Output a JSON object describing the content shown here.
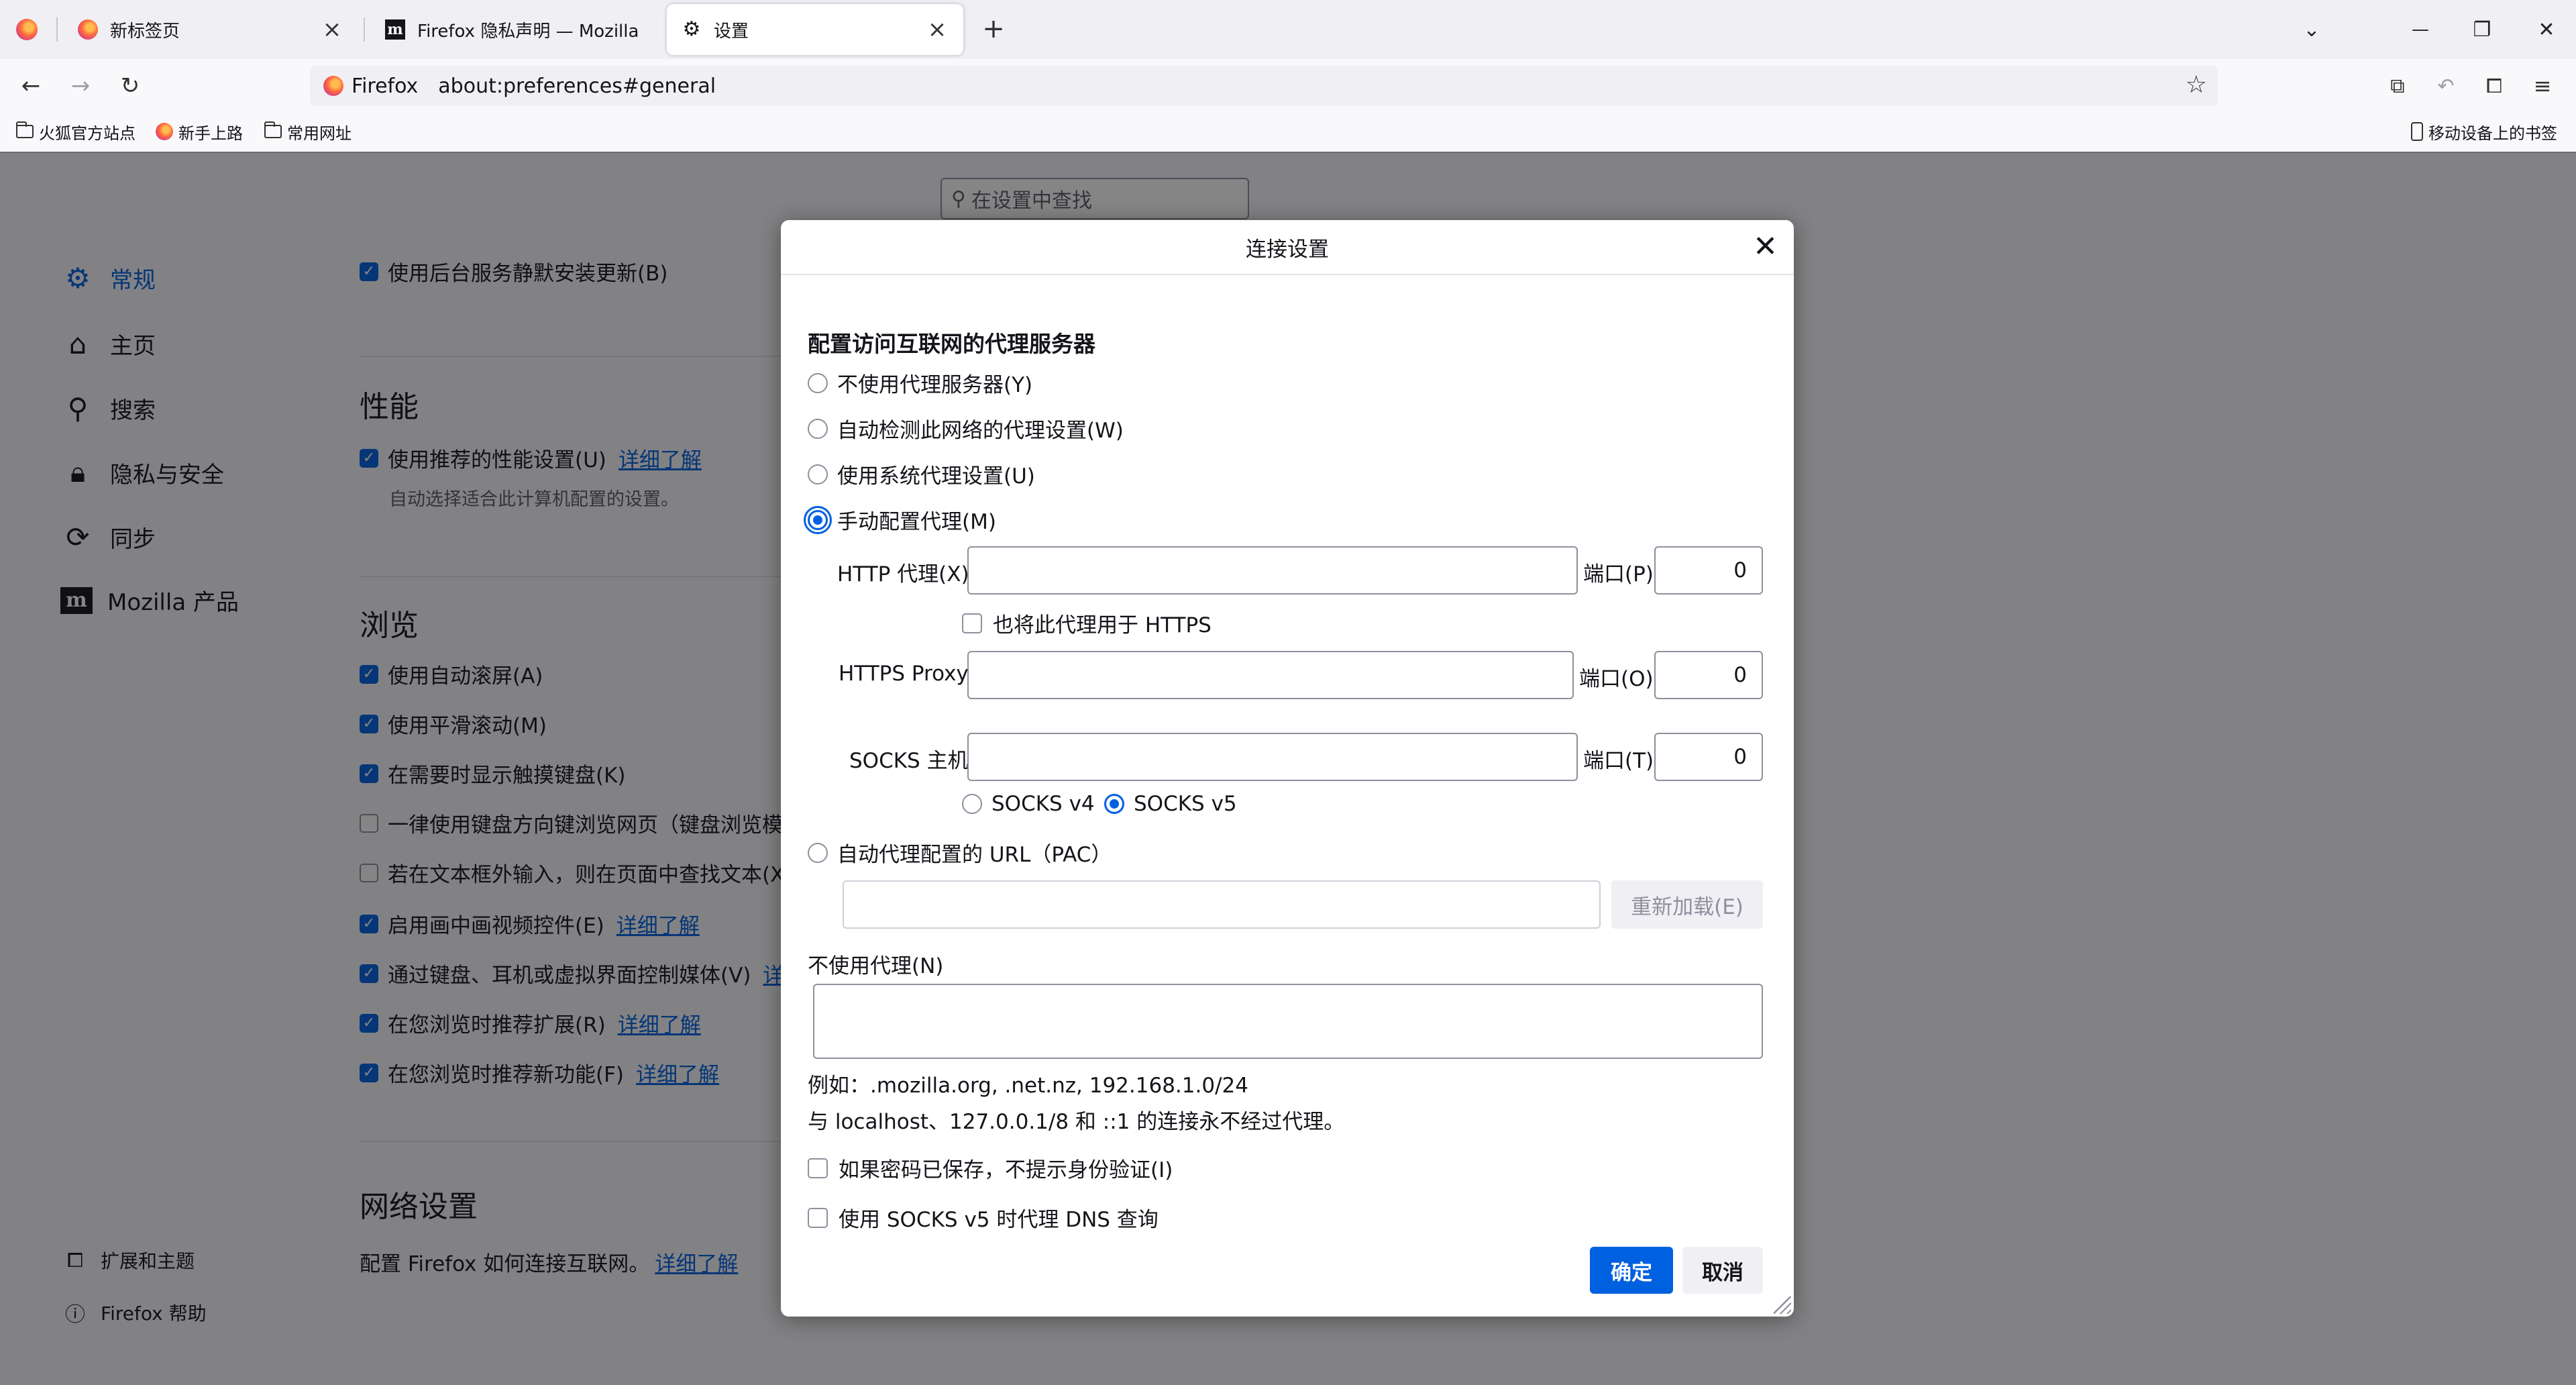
{
  "tabs": [
    {
      "label": ""
    },
    {
      "label": "新标签页"
    },
    {
      "label": "Firefox 隐私声明 — Mozilla"
    },
    {
      "label": "设置"
    }
  ],
  "tab_close": "×",
  "new_tab": "+",
  "window_controls": {
    "list": "⌄",
    "minimize": "—",
    "restore": "❐",
    "close": "✕"
  },
  "nav": {
    "back": "←",
    "forward": "→",
    "reload": "↻"
  },
  "urlbar": {
    "identity": "Firefox",
    "url": "about:preferences#general"
  },
  "toolbar_icons": [
    "crop-icon",
    "undo-icon",
    "extensions-icon",
    "menu-icon"
  ],
  "bookmarks": [
    {
      "label": "火狐官方站点"
    },
    {
      "label": "新手上路"
    },
    {
      "label": "常用网址"
    }
  ],
  "mobile_bookmarks": "移动设备上的书签",
  "prefs_search_placeholder": "在设置中查找",
  "categories": [
    {
      "label": "常规",
      "icon": "gear-icon"
    },
    {
      "label": "主页",
      "icon": "home-icon"
    },
    {
      "label": "搜索",
      "icon": "search-icon"
    },
    {
      "label": "隐私与安全",
      "icon": "lock-icon"
    },
    {
      "label": "同步",
      "icon": "sync-icon"
    },
    {
      "label": "Mozilla 产品",
      "icon": "mozilla-icon"
    }
  ],
  "footer_links": [
    {
      "label": "扩展和主题"
    },
    {
      "label": "Firefox 帮助"
    }
  ],
  "general": {
    "background_update": "使用后台服务静默安装更新(B)",
    "perf_title": "性能",
    "perf_recommended": "使用推荐的性能设置(U)",
    "learn_more": "详细了解",
    "perf_desc": "自动选择适合此计算机配置的设置。",
    "browsing_title": "浏览",
    "browsing": [
      {
        "label": "使用自动滚屏(A)",
        "checked": true,
        "link": ""
      },
      {
        "label": "使用平滑滚动(M)",
        "checked": true,
        "link": ""
      },
      {
        "label": "在需要时显示触摸键盘(K)",
        "checked": true,
        "link": ""
      },
      {
        "label": "一律使用键盘方向键浏览网页（键盘浏览模式",
        "checked": false,
        "link": ""
      },
      {
        "label": "若在文本框外输入，则在页面中查找文本(X)",
        "checked": false,
        "link": ""
      },
      {
        "label": "启用画中画视频控件(E)",
        "checked": true,
        "link": "详细了解"
      },
      {
        "label": "通过键盘、耳机或虚拟界面控制媒体(V)",
        "checked": true,
        "link": "详纟"
      },
      {
        "label": "在您浏览时推荐扩展(R)",
        "checked": true,
        "link": "详细了解"
      },
      {
        "label": "在您浏览时推荐新功能(F)",
        "checked": true,
        "link": "详细了解"
      }
    ],
    "network_title": "网络设置",
    "network_desc": "配置 Firefox 如何连接互联网。",
    "network_link": "详细了解"
  },
  "dialog": {
    "title": "连接设置",
    "close": "✕",
    "heading": "配置访问互联网的代理服务器",
    "options": {
      "no_proxy": "不使用代理服务器(Y)",
      "auto_detect": "自动检测此网络的代理设置(W)",
      "system": "使用系统代理设置(U)",
      "manual": "手动配置代理(M)",
      "pac": "自动代理配置的 URL（PAC）"
    },
    "selected": "manual",
    "http_label": "HTTP 代理(X)",
    "http_value": "",
    "http_port_label": "端口(P)",
    "http_port": "0",
    "also_https": "也将此代理用于 HTTPS",
    "https_label": "HTTPS Proxy",
    "https_value": "",
    "https_port_label": "端口(O)",
    "https_port": "0",
    "socks_label": "SOCKS 主机",
    "socks_value": "",
    "socks_port_label": "端口(T)",
    "socks_port": "0",
    "socks_v4": "SOCKS v4",
    "socks_v5": "SOCKS v5",
    "socks_version_selected": "v5",
    "pac_url": "",
    "reload": "重新加载(E)",
    "no_proxy_for_label": "不使用代理(N)",
    "no_proxy_for_value": "",
    "example": "例如：.mozilla.org, .net.nz, 192.168.1.0/24",
    "localhost_note": "与 localhost、127.0.0.1/8 和 ::1 的连接永不经过代理。",
    "no_auth_prompt": "如果密码已保存，不提示身份验证(I)",
    "socks_dns": "使用 SOCKS v5 时代理 DNS 查询",
    "ok": "确定",
    "cancel": "取消"
  },
  "colors": {
    "accent": "#0061e0",
    "overlay": "rgba(12,12,13,0.5)"
  }
}
